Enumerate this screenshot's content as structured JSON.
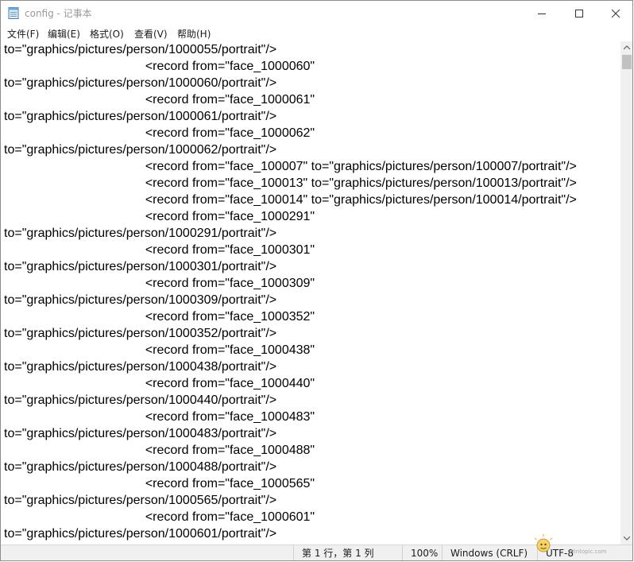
{
  "window": {
    "title": "config - 记事本",
    "controls": {
      "minimize": "─",
      "maximize": "☐",
      "close": "✕"
    }
  },
  "menu": [
    {
      "label": "文件(F)"
    },
    {
      "label": "编辑(E)"
    },
    {
      "label": "格式(O)"
    },
    {
      "label": "查看(V)"
    },
    {
      "label": "帮助(H)"
    }
  ],
  "editor": {
    "lines": [
      "to=\"graphics/pictures/person/1000055/portrait\"/>",
      "                                        <record from=\"face_1000060\"",
      "to=\"graphics/pictures/person/1000060/portrait\"/>",
      "                                        <record from=\"face_1000061\"",
      "to=\"graphics/pictures/person/1000061/portrait\"/>",
      "                                        <record from=\"face_1000062\"",
      "to=\"graphics/pictures/person/1000062/portrait\"/>",
      "                                        <record from=\"face_100007\" to=\"graphics/pictures/person/100007/portrait\"/>",
      "                                        <record from=\"face_100013\" to=\"graphics/pictures/person/100013/portrait\"/>",
      "                                        <record from=\"face_100014\" to=\"graphics/pictures/person/100014/portrait\"/>",
      "                                        <record from=\"face_1000291\"",
      "to=\"graphics/pictures/person/1000291/portrait\"/>",
      "                                        <record from=\"face_1000301\"",
      "to=\"graphics/pictures/person/1000301/portrait\"/>",
      "                                        <record from=\"face_1000309\"",
      "to=\"graphics/pictures/person/1000309/portrait\"/>",
      "                                        <record from=\"face_1000352\"",
      "to=\"graphics/pictures/person/1000352/portrait\"/>",
      "                                        <record from=\"face_1000438\"",
      "to=\"graphics/pictures/person/1000438/portrait\"/>",
      "                                        <record from=\"face_1000440\"",
      "to=\"graphics/pictures/person/1000440/portrait\"/>",
      "                                        <record from=\"face_1000483\"",
      "to=\"graphics/pictures/person/1000483/portrait\"/>",
      "                                        <record from=\"face_1000488\"",
      "to=\"graphics/pictures/person/1000488/portrait\"/>",
      "                                        <record from=\"face_1000565\"",
      "to=\"graphics/pictures/person/1000565/portrait\"/>",
      "                                        <record from=\"face_1000601\"",
      "to=\"graphics/pictures/person/1000601/portrait\"/>"
    ]
  },
  "status": {
    "position": "第 1 行，第 1 列",
    "zoom": "100%",
    "line_ending": "Windows (CRLF)",
    "encoding": "UTF-8"
  },
  "watermark": {
    "text": "Wintopic.com"
  }
}
